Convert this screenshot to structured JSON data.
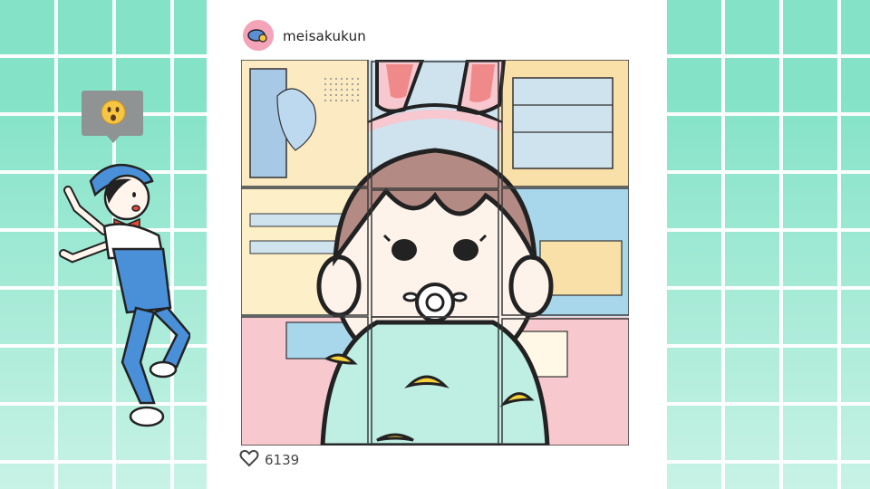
{
  "post": {
    "username": "meisakukun",
    "likes": "6139"
  },
  "speech_bubble": {
    "emoji": "surprised-face"
  },
  "puzzle": {
    "rows": 3,
    "cols": 3,
    "state": "scrambled-tiles"
  },
  "colors": {
    "grid_bg": "#84e3c7",
    "card": "#ffffff",
    "avatar": "#f3a4b8",
    "overalls": "#4a90d9"
  }
}
